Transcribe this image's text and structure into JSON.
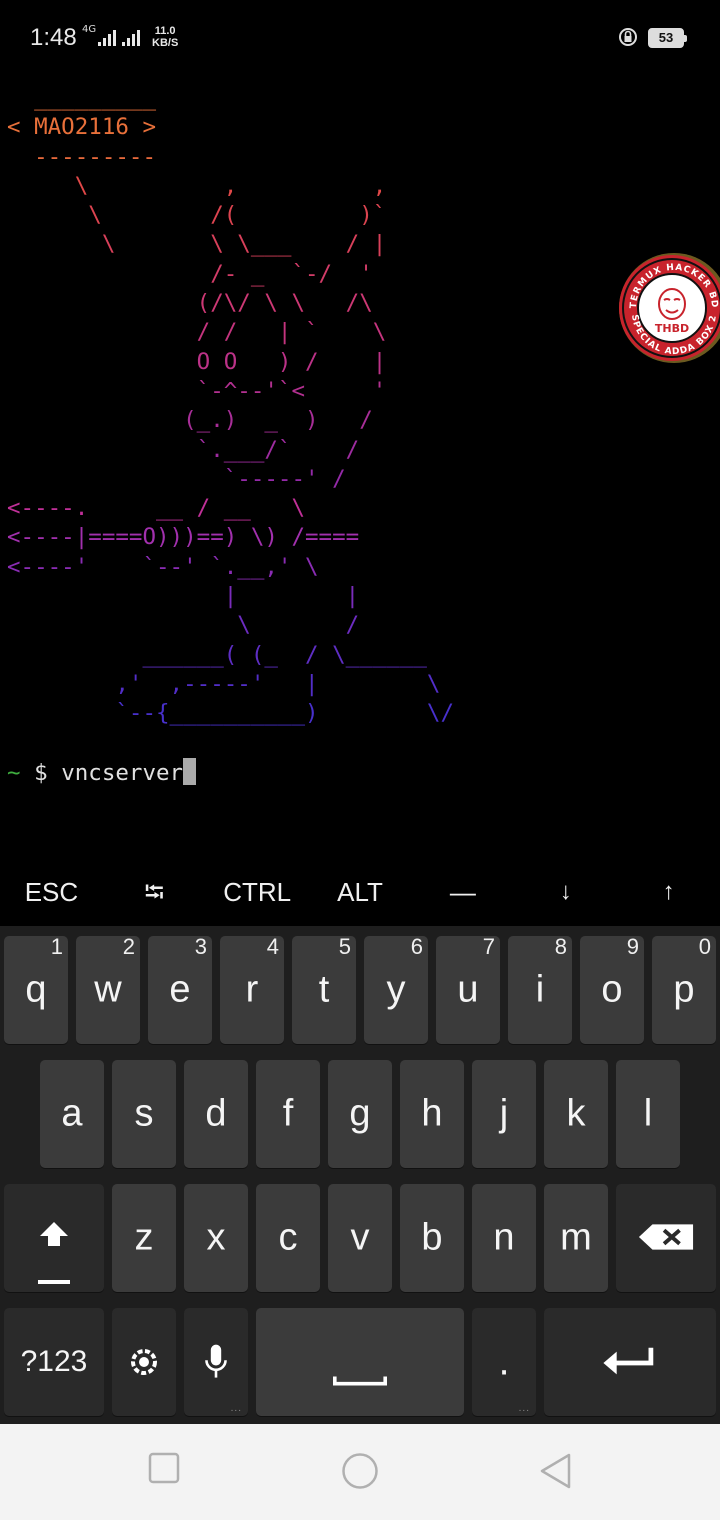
{
  "status_bar": {
    "time": "1:48",
    "network_type": "4G",
    "speed_value": "11.0",
    "speed_unit": "KB/S",
    "battery_level": "53",
    "icons": [
      "signal-icon",
      "rotation-lock-icon",
      "battery-icon"
    ]
  },
  "terminal": {
    "ascii_art": [
      {
        "text": "  _________",
        "color": "#e8703a"
      },
      {
        "text": "< MAO2116 >",
        "color": "#e8703a"
      },
      {
        "text": "  ---------",
        "color": "#e86a3c"
      },
      {
        "text": "     \\          ,          ,",
        "color": "#e04848"
      },
      {
        "text": "      \\        /(         )`",
        "color": "#dc4450"
      },
      {
        "text": "       \\       \\ \\___    / |",
        "color": "#d8405a"
      },
      {
        "text": "               /- _  `-/  '",
        "color": "#d23c68"
      },
      {
        "text": "              (/\\/ \\ \\   /\\",
        "color": "#cc3874"
      },
      {
        "text": "              / /   | `    \\",
        "color": "#c4347e"
      },
      {
        "text": "              O O   ) /    |",
        "color": "#bc3288"
      },
      {
        "text": "              `-^--'`<     '",
        "color": "#b23090"
      },
      {
        "text": "             (_.)  _  )   /",
        "color": "#a82e98"
      },
      {
        "text": "              `.___/`    /",
        "color": "#9e2ca0"
      },
      {
        "text": "                `-----' /",
        "color": "#942aa8"
      },
      {
        "text": "<----.     __ / __   \\",
        "color": "#c03098"
      },
      {
        "text": "<----|====O)))==) \\) /====",
        "color": "#a230ae"
      },
      {
        "text": "<----'    `--' `.__,' \\",
        "color": "#8a2cb4"
      },
      {
        "text": "                |        |",
        "color": "#7a2cba"
      },
      {
        "text": "                 \\       /",
        "color": "#6c2cc0"
      },
      {
        "text": "          ______( (_  / \\______",
        "color": "#5e2ec4"
      },
      {
        "text": "        ,'  ,-----'   |        \\",
        "color": "#522ec8"
      },
      {
        "text": "        `--{__________)        \\/",
        "color": "#4830cc"
      }
    ],
    "prompt_symbol": "~",
    "prompt_dollar": "$",
    "command": "vncserver"
  },
  "badge": {
    "top_text": "TERMUX HACKER BD",
    "bottom_text": "SPECIAL ADDA BOX 2",
    "center_text": "THBD"
  },
  "extra_keys": [
    "ESC",
    "⭾",
    "CTRL",
    "ALT",
    "—",
    "↓",
    "↑"
  ],
  "keyboard": {
    "row1": [
      {
        "key": "q",
        "num": "1"
      },
      {
        "key": "w",
        "num": "2"
      },
      {
        "key": "e",
        "num": "3"
      },
      {
        "key": "r",
        "num": "4"
      },
      {
        "key": "t",
        "num": "5"
      },
      {
        "key": "y",
        "num": "6"
      },
      {
        "key": "u",
        "num": "7"
      },
      {
        "key": "i",
        "num": "8"
      },
      {
        "key": "o",
        "num": "9"
      },
      {
        "key": "p",
        "num": "0"
      }
    ],
    "row2": [
      "a",
      "s",
      "d",
      "f",
      "g",
      "h",
      "j",
      "k",
      "l"
    ],
    "row3": [
      "z",
      "x",
      "c",
      "v",
      "b",
      "n",
      "m"
    ],
    "symbols_label": "?123",
    "period_label": "."
  },
  "navbar": {
    "buttons": [
      "recent-apps",
      "home",
      "back"
    ]
  },
  "colors": {
    "background": "#000000",
    "keyboard_bg": "#1e1e1e",
    "key_bg": "#3b3b3b",
    "navbar_bg": "#f3f3f3",
    "prompt_green": "#3fae3f"
  }
}
